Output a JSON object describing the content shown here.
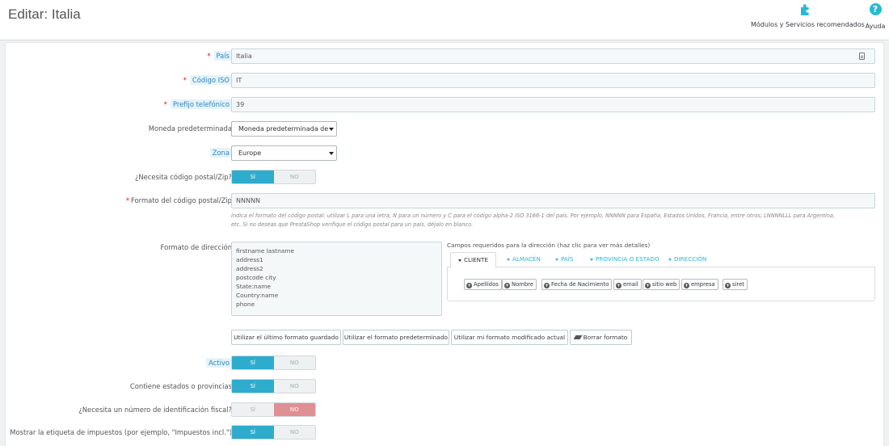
{
  "header": {
    "title": "Editar: Italia",
    "modules_label": "Módulos y Servicios recomendados",
    "help_label": "Ayuda",
    "help_symbol": "?"
  },
  "form": {
    "country": {
      "label": "País",
      "value": "Italia"
    },
    "iso": {
      "label": "Código ISO",
      "value": "IT"
    },
    "prefix": {
      "label": "Prefijo telefónico",
      "value": "39"
    },
    "currency": {
      "label": "Moneda predeterminada",
      "value": "Moneda predeterminada de la tienda"
    },
    "zone": {
      "label": "Zona",
      "value": "Europe"
    },
    "need_zip": {
      "label": "¿Necesita código postal/Zip?",
      "yes": "SÍ",
      "no": "NO",
      "selected": "yes"
    },
    "zip_format": {
      "label": "Formato del código postal/Zip",
      "value": "NNNNN",
      "help_1": "Indica el formato del código postal: utilizar L para una letra, N para un número y C para el código alpha-2 ISO 3166-1 del país. Por ejemplo, NNNNN para España, Estados Unidos, Francia, entre otros; LNNNNLLL para Argentina,",
      "help_2": "etc. Si no deseas que PrestaShop verifique el código postal para un país, déjalo en blanco."
    },
    "address_format": {
      "label": "Formato de dirección",
      "lines": [
        "firstname lastname",
        "address1",
        "address2",
        "postcode city",
        "State:name",
        "Country:name",
        "phone"
      ],
      "fields_title": "Campos requeridos para la dirección (haz clic para ver más detalles)",
      "tabs": [
        "CLIENTE",
        "ALMACÉN",
        "PAÍS",
        "PROVINCIA O ESTADO",
        "DIRECCIÓN"
      ],
      "chips": [
        "Apellidos",
        "Nombre",
        "Fecha de Nacimiento",
        "email",
        "sitio web",
        "empresa",
        "siret"
      ],
      "plus_symbol": "+"
    },
    "buttons": {
      "last_saved": "Utilizar el último formato guardado",
      "default": "Utilizar el formato predeterminado",
      "modified": "Utilizar mi formato modificado actual",
      "clear": "Borrar formato"
    },
    "active": {
      "label": "Activo",
      "yes": "SÍ",
      "no": "NO",
      "selected": "yes"
    },
    "contains_states": {
      "label": "Contiene estados o provincias",
      "yes": "SÍ",
      "no": "NO",
      "selected": "yes"
    },
    "need_tax_id": {
      "label": "¿Necesita un número de identificación fiscal?",
      "yes": "SÍ",
      "no": "NO",
      "selected": "no"
    },
    "display_tax_label": {
      "label": "Mostrar la etiqueta de impuestos (por ejemplo, \"Impuestos incl.\")",
      "yes": "SÍ",
      "no": "NO",
      "selected": "yes"
    }
  },
  "colors": {
    "accent": "#25b9d7",
    "switch_on": "#2eacce",
    "switch_no_on": "#e08f95",
    "required": "#ee0000"
  }
}
